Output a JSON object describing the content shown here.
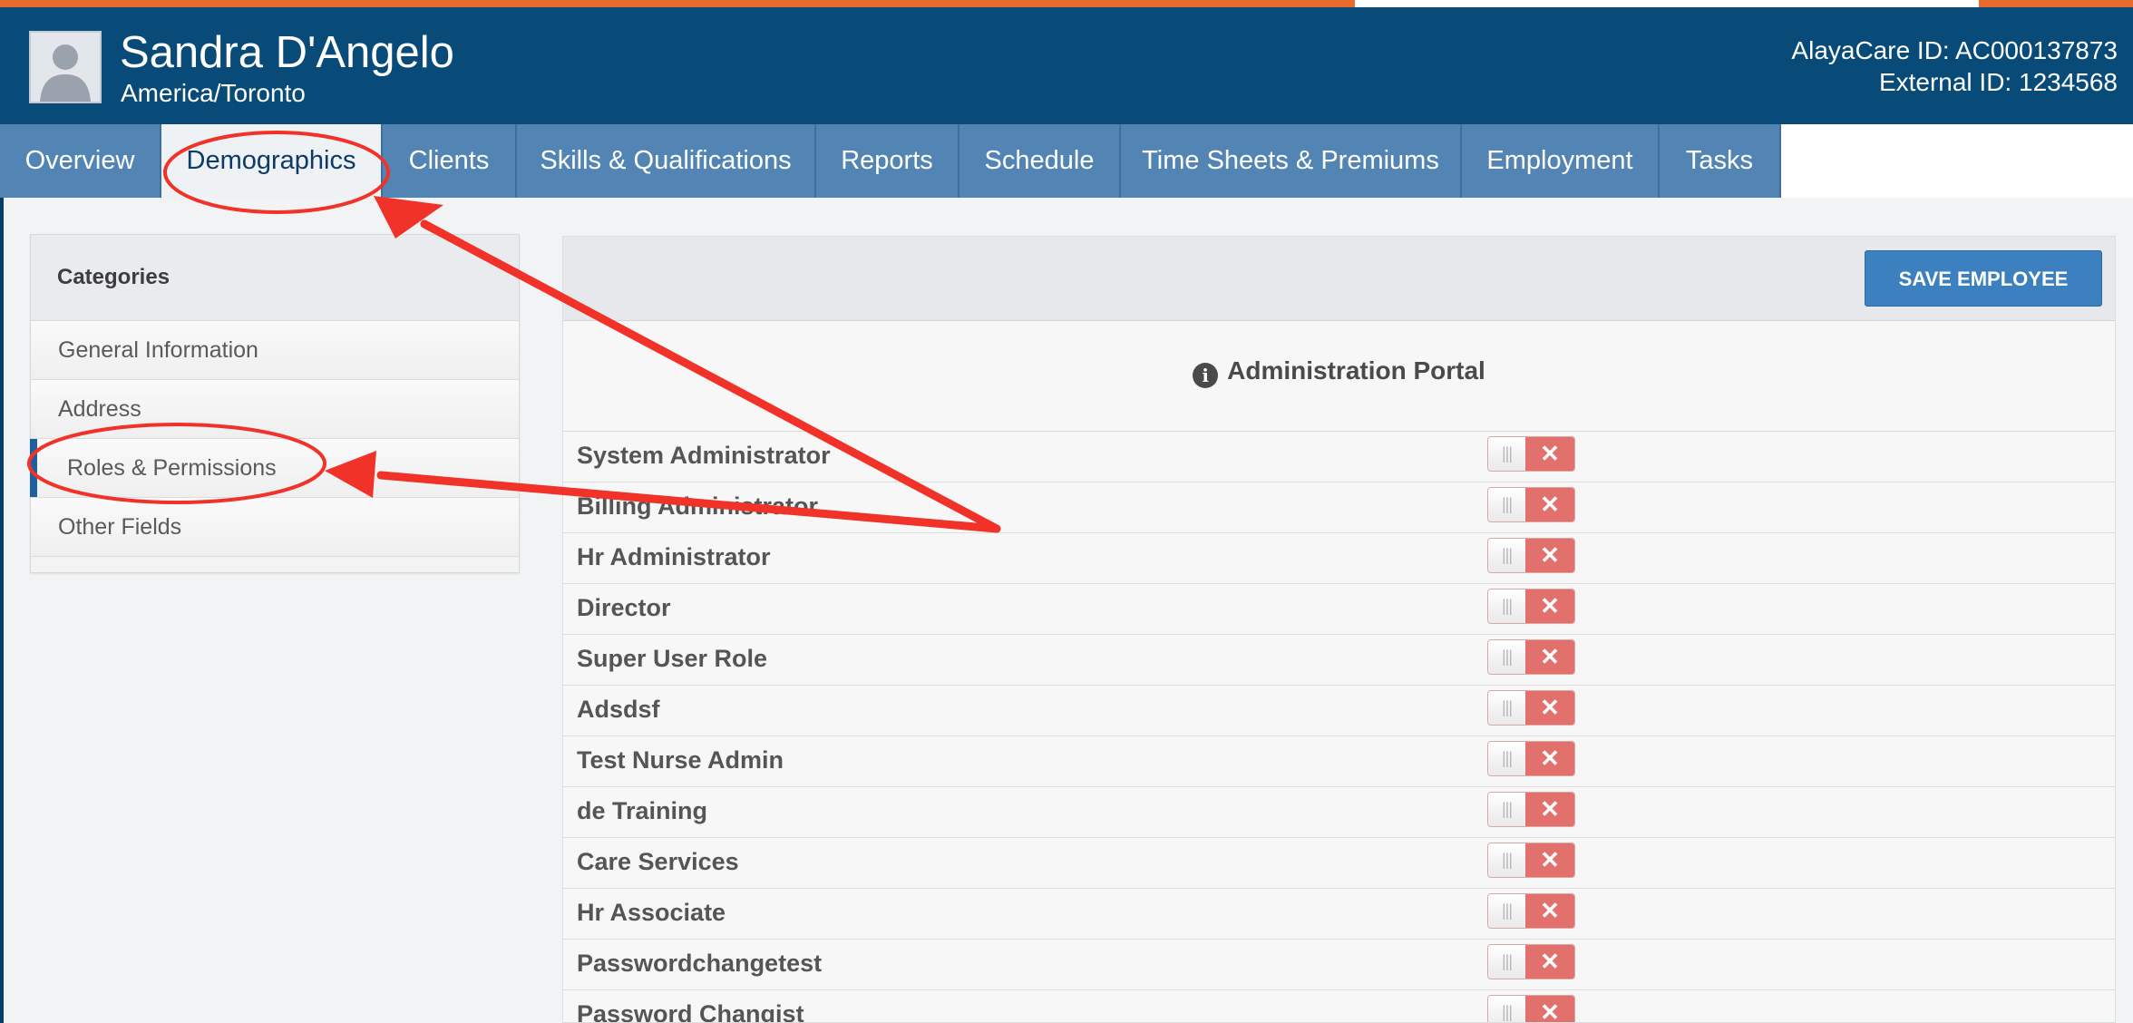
{
  "header": {
    "name": "Sandra D'Angelo",
    "timezone": "America/Toronto",
    "alayacare_id": "AlayaCare ID: AC000137873",
    "external_id": "External ID: 1234568"
  },
  "tabs": [
    {
      "label": "Overview",
      "active": false
    },
    {
      "label": "Demographics",
      "active": true
    },
    {
      "label": "Clients",
      "active": false
    },
    {
      "label": "Skills & Qualifications",
      "active": false
    },
    {
      "label": "Reports",
      "active": false
    },
    {
      "label": "Schedule",
      "active": false
    },
    {
      "label": "Time Sheets & Premiums",
      "active": false
    },
    {
      "label": "Employment",
      "active": false
    },
    {
      "label": "Tasks",
      "active": false
    }
  ],
  "categories": {
    "heading": "Categories",
    "items": [
      {
        "label": "General Information",
        "active": false
      },
      {
        "label": "Address",
        "active": false
      },
      {
        "label": "Roles & Permissions",
        "active": true
      },
      {
        "label": "Other Fields",
        "active": false
      }
    ]
  },
  "main": {
    "save_label": "SAVE EMPLOYEE",
    "section_title": "Administration Portal",
    "roles": [
      {
        "name": "System Administrator",
        "enabled": false
      },
      {
        "name": "Billing Administrator",
        "enabled": false
      },
      {
        "name": "Hr Administrator",
        "enabled": false
      },
      {
        "name": "Director",
        "enabled": false
      },
      {
        "name": "Super User Role",
        "enabled": false
      },
      {
        "name": "Adsdsf",
        "enabled": false
      },
      {
        "name": "Test Nurse Admin",
        "enabled": false
      },
      {
        "name": "de Training",
        "enabled": false
      },
      {
        "name": "Care Services",
        "enabled": false
      },
      {
        "name": "Hr Associate",
        "enabled": false
      },
      {
        "name": "Passwordchangetest",
        "enabled": false
      },
      {
        "name": "Password Changist",
        "enabled": false
      }
    ],
    "toggle_off_glyph": "✕",
    "toggle_grip_glyph": "|||"
  },
  "colors": {
    "header_bg": "#084b78",
    "accent_orange": "#e86a2c",
    "tab_bar": "#5285b4",
    "save_button": "#3c80bf",
    "toggle_off": "#e2716e",
    "annotation_red": "#f03228"
  },
  "icons": {
    "avatar": "person-silhouette-icon",
    "section_info": "info-circle-icon",
    "toggle_off": "x-icon"
  }
}
